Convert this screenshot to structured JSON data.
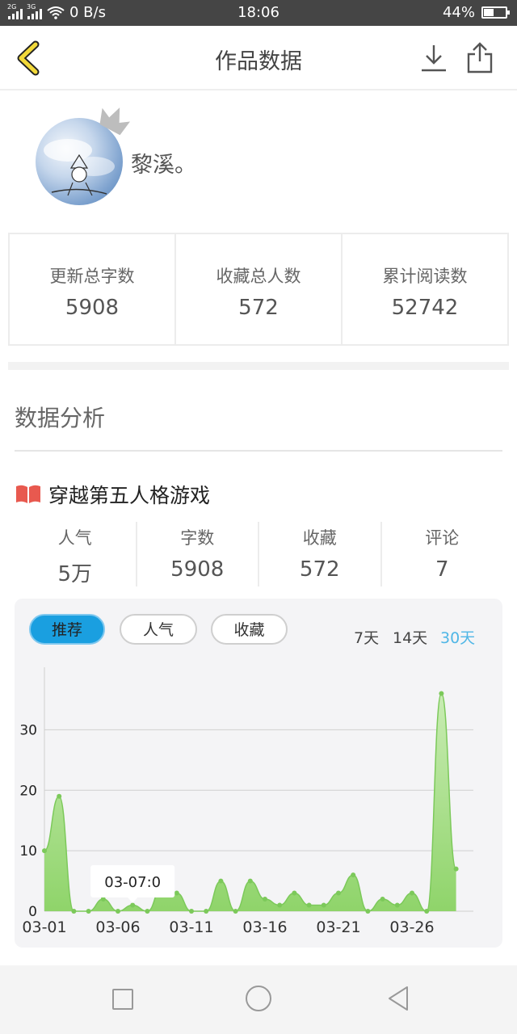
{
  "status_bar": {
    "network_left": "2G",
    "network_right": "3G",
    "speed": "0 B/s",
    "time": "18:06",
    "battery": "44%",
    "battery_level": 0.44
  },
  "header": {
    "title": "作品数据",
    "icons": [
      "chevron-left-icon",
      "download-icon",
      "share-icon"
    ]
  },
  "profile": {
    "username": "黎溪。"
  },
  "summary": [
    {
      "label": "更新总字数",
      "value": "5908"
    },
    {
      "label": "收藏总人数",
      "value": "572"
    },
    {
      "label": "累计阅读数",
      "value": "52742"
    }
  ],
  "analysis": {
    "title": "数据分析"
  },
  "book": {
    "name": "穿越第五人格游戏",
    "stats": [
      {
        "label": "人气",
        "value": "5万"
      },
      {
        "label": "字数",
        "value": "5908"
      },
      {
        "label": "收藏",
        "value": "572"
      },
      {
        "label": "评论",
        "value": "7"
      }
    ]
  },
  "chart_controls": {
    "tabs": [
      "推荐",
      "人气",
      "收藏"
    ],
    "active_tab": "推荐",
    "ranges": [
      "7天",
      "14天",
      "30天"
    ],
    "active_range": "30天"
  },
  "colors": {
    "accent_blue": "#1a9fe0",
    "range_selected": "#4fb6e6",
    "area_green": "#8fd46a"
  },
  "chart_data": {
    "type": "area",
    "x": [
      "03-01",
      "03-02",
      "03-03",
      "03-04",
      "03-05",
      "03-06",
      "03-07",
      "03-08",
      "03-09",
      "03-10",
      "03-11",
      "03-12",
      "03-13",
      "03-14",
      "03-15",
      "03-16",
      "03-17",
      "03-18",
      "03-19",
      "03-20",
      "03-21",
      "03-22",
      "03-23",
      "03-24",
      "03-25",
      "03-26",
      "03-27",
      "03-28",
      "03-29",
      "03-30",
      "03-31"
    ],
    "values": [
      10,
      19,
      0,
      0,
      2,
      0,
      1,
      0,
      4,
      3,
      0,
      0,
      5,
      0,
      5,
      2,
      1,
      3,
      1,
      1,
      3,
      6,
      0,
      2,
      1,
      3,
      0,
      36,
      7,
      null,
      null
    ],
    "x_tick_labels": [
      "03-01",
      "03-06",
      "03-11",
      "03-16",
      "03-21",
      "03-26"
    ],
    "y_ticks": [
      0,
      10,
      20,
      30
    ],
    "ylim": [
      0,
      39
    ],
    "grid": "horizontal",
    "tooltip": "03-07:0"
  }
}
